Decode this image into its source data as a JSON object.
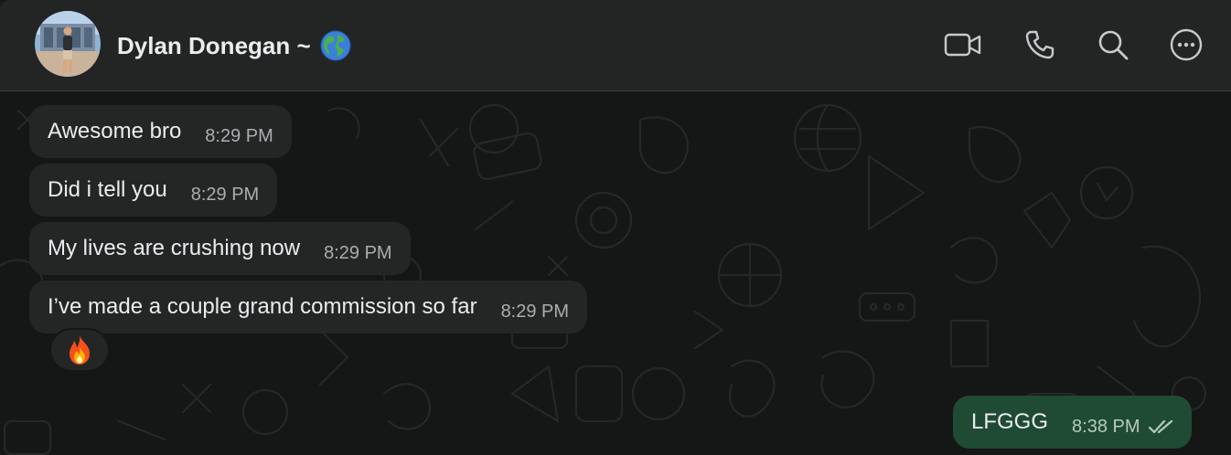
{
  "header": {
    "contact_name": "Dylan Donegan ~",
    "name_emoji_icon": "globe-emoji-icon",
    "actions": [
      {
        "name": "video-call-icon"
      },
      {
        "name": "voice-call-icon"
      },
      {
        "name": "search-icon"
      },
      {
        "name": "more-options-icon"
      }
    ]
  },
  "messages": [
    {
      "direction": "incoming",
      "text": "Awesome bro",
      "time": "8:29 PM"
    },
    {
      "direction": "incoming",
      "text": "Did i tell you",
      "time": "8:29 PM"
    },
    {
      "direction": "incoming",
      "text": "My lives are crushing now",
      "time": "8:29 PM"
    },
    {
      "direction": "incoming",
      "text": "I’ve made a couple grand commission so far",
      "time": "8:29 PM",
      "reaction": "fire-emoji-icon"
    },
    {
      "direction": "outgoing",
      "text": "LFGGG",
      "time": "8:38 PM",
      "status": "read-double-check-icon"
    }
  ],
  "colors": {
    "header_bg": "#232525",
    "chat_bg": "#151616",
    "incoming_bubble": "#242626",
    "outgoing_bubble": "#1f4a33",
    "text": "#e9edef",
    "timestamp": "#a9aeb0"
  }
}
